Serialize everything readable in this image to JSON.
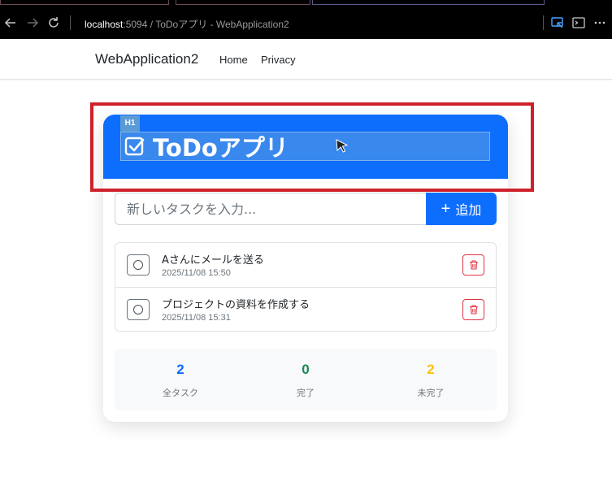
{
  "browser": {
    "url_host": "localhost",
    "url_rest": ":5094 / ToDoアプリ - WebApplication2",
    "icons": [
      "back-icon",
      "forward-icon",
      "reload-icon",
      "inspect-icon",
      "console-icon",
      "more-icon"
    ]
  },
  "navbar": {
    "brand": "WebApplication2",
    "links": [
      {
        "label": "Home"
      },
      {
        "label": "Privacy"
      }
    ]
  },
  "inspector": {
    "tag": "H1"
  },
  "header": {
    "title": "ToDoアプリ",
    "icon": "check-square-icon"
  },
  "form": {
    "placeholder": "新しいタスクを入力...",
    "value": "",
    "add_label": "追加"
  },
  "tasks": [
    {
      "title": "Aさんにメールを送る",
      "date": "2025/11/08 15:50",
      "completed": false
    },
    {
      "title": "プロジェクトの資料を作成する",
      "date": "2025/11/08 15:31",
      "completed": false
    }
  ],
  "stats": {
    "total": {
      "value": "2",
      "label": "全タスク",
      "color": "#0d6efd"
    },
    "done": {
      "value": "0",
      "label": "完了",
      "color": "#198754"
    },
    "pending": {
      "value": "2",
      "label": "未完了",
      "color": "#ffc107"
    }
  },
  "colors": {
    "primary": "#0d6efd",
    "danger": "#dc3545",
    "highlight": "#d0202a"
  }
}
